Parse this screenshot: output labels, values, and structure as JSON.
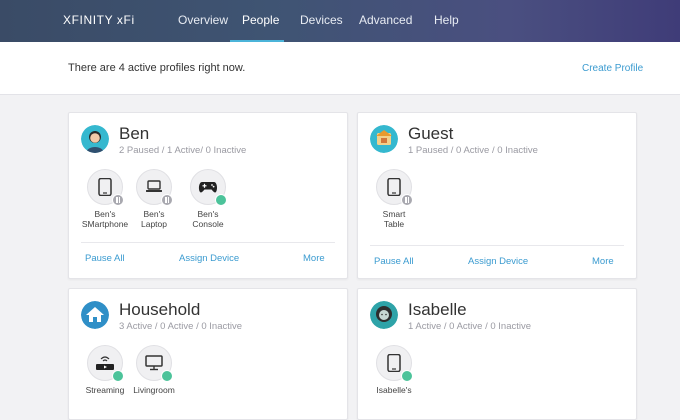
{
  "nav": {
    "brand": "XFINITY xFi",
    "tabs": [
      {
        "label": "Overview"
      },
      {
        "label": "People"
      },
      {
        "label": "Devices"
      },
      {
        "label": "Advanced"
      },
      {
        "label": "Help"
      }
    ],
    "active_tab": "People",
    "accent": "#4bb4d9"
  },
  "info": {
    "text": "There are 4 active profiles right now.",
    "create_link": "Create Profile"
  },
  "profiles": [
    {
      "name": "Ben",
      "status": "2 Paused / 1 Active/ 0 Inactive",
      "devices": [
        {
          "line1": "Ben's",
          "line2": "SMartphone",
          "icon": "smartphone-icon",
          "state": "paused"
        },
        {
          "line1": "Ben's",
          "line2": "Laptop",
          "icon": "laptop-icon",
          "state": "paused"
        },
        {
          "line1": "Ben's",
          "line2": "Console",
          "icon": "game-controller-icon",
          "state": "active"
        }
      ],
      "actions": [
        "Pause All",
        "Assign Device",
        "More"
      ]
    },
    {
      "name": "Guest",
      "status": "1 Paused / 0 Active / 0 Inactive",
      "devices": [
        {
          "line1": "Smart",
          "line2": "Table",
          "icon": "smartphone-icon",
          "state": "paused"
        }
      ],
      "actions": [
        "Pause All",
        "Assign Device",
        "More"
      ]
    },
    {
      "name": "Household",
      "status": "3 Active / 0 Active / 0 Inactive",
      "devices": [
        {
          "line1": "Streaming",
          "line2": "",
          "icon": "streaming-box-icon",
          "state": "active"
        },
        {
          "line1": "Livingroom",
          "line2": "",
          "icon": "tv-icon",
          "state": "active"
        }
      ]
    },
    {
      "name": "Isabelle",
      "status": "1 Active / 0 Active / 0 Inactive",
      "devices": [
        {
          "line1": "Isabelle's",
          "line2": "",
          "icon": "smartphone-icon",
          "state": "active"
        }
      ]
    }
  ],
  "colors": {
    "link": "#3b9bd0",
    "active_badge": "#4cc39a",
    "paused_badge": "#a9a9b0"
  }
}
